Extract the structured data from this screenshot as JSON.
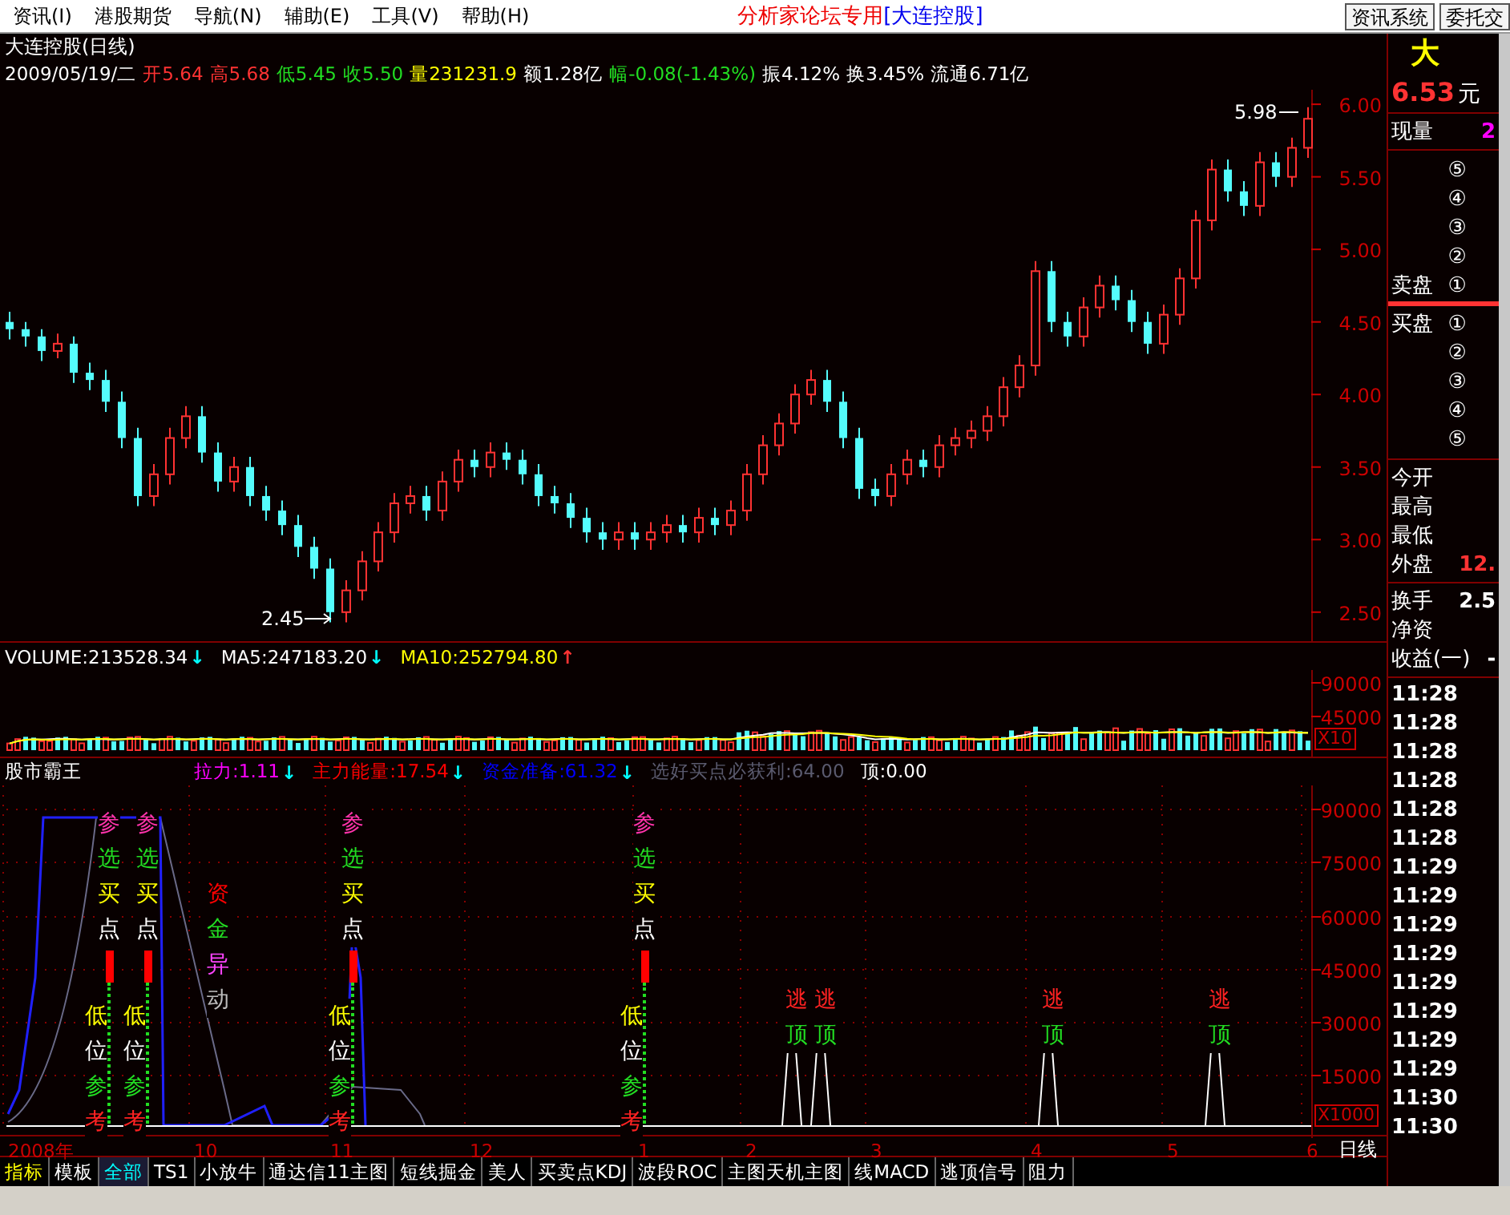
{
  "menu": [
    "资讯(I)",
    "港股期货",
    "导航(N)",
    "辅助(E)",
    "工具(V)",
    "帮助(H)"
  ],
  "banner": {
    "forum": "分析家论坛专用",
    "stock": "[大连控股]"
  },
  "top_buttons": [
    "资讯系统",
    "委托交"
  ],
  "chart": {
    "title": "大连控股(日线)",
    "quote": [
      {
        "kind": "plain",
        "text": "2009/05/19/二"
      },
      {
        "kind": "up",
        "text": "开5.64"
      },
      {
        "kind": "up",
        "text": "高5.68"
      },
      {
        "kind": "down",
        "text": "低5.45"
      },
      {
        "kind": "down",
        "text": "收5.50"
      },
      {
        "kind": "volume",
        "text": "量231231.9"
      },
      {
        "kind": "plain",
        "text": "额1.28亿"
      },
      {
        "kind": "down",
        "text": "幅-0.08(-1.43%)"
      },
      {
        "kind": "plain",
        "text": "振4.12%"
      },
      {
        "kind": "plain",
        "text": "换3.45%"
      },
      {
        "kind": "plain",
        "text": "流通6.71亿"
      }
    ],
    "high_mark": "5.98",
    "low_mark": "2.45",
    "chart_data": {
      "type": "candlestick",
      "ylim": [
        2.3,
        6.1
      ],
      "yticks": [
        {
          "value": 6,
          "label": "6.00"
        },
        {
          "value": 5.5,
          "label": "5.50"
        },
        {
          "value": 5,
          "label": "5.00"
        },
        {
          "value": 4.5,
          "label": "4.50"
        },
        {
          "value": 4,
          "label": "4.00"
        },
        {
          "value": 3.5,
          "label": "3.50"
        },
        {
          "value": 3,
          "label": "3.00"
        },
        {
          "value": 2.5,
          "label": "2.50"
        }
      ],
      "ohlc": [
        [
          4.5,
          4.57,
          4.38,
          4.45
        ],
        [
          4.45,
          4.5,
          4.33,
          4.4
        ],
        [
          4.4,
          4.45,
          4.23,
          4.3
        ],
        [
          4.3,
          4.42,
          4.25,
          4.35
        ],
        [
          4.35,
          4.4,
          4.08,
          4.15
        ],
        [
          4.15,
          4.22,
          4.03,
          4.1
        ],
        [
          4.1,
          4.17,
          3.88,
          3.95
        ],
        [
          3.95,
          4.02,
          3.63,
          3.7
        ],
        [
          3.7,
          3.77,
          3.23,
          3.3
        ],
        [
          3.3,
          3.52,
          3.23,
          3.45
        ],
        [
          3.45,
          3.77,
          3.38,
          3.7
        ],
        [
          3.7,
          3.92,
          3.63,
          3.85
        ],
        [
          3.85,
          3.92,
          3.53,
          3.6
        ],
        [
          3.6,
          3.67,
          3.33,
          3.4
        ],
        [
          3.4,
          3.57,
          3.33,
          3.5
        ],
        [
          3.5,
          3.57,
          3.23,
          3.3
        ],
        [
          3.3,
          3.37,
          3.13,
          3.2
        ],
        [
          3.2,
          3.27,
          3.03,
          3.1
        ],
        [
          3.1,
          3.17,
          2.88,
          2.95
        ],
        [
          2.95,
          3.02,
          2.73,
          2.8
        ],
        [
          2.8,
          2.87,
          2.43,
          2.5
        ],
        [
          2.5,
          2.72,
          2.43,
          2.65
        ],
        [
          2.65,
          2.92,
          2.58,
          2.85
        ],
        [
          2.85,
          3.12,
          2.78,
          3.05
        ],
        [
          3.05,
          3.32,
          2.98,
          3.25
        ],
        [
          3.25,
          3.37,
          3.18,
          3.3
        ],
        [
          3.3,
          3.37,
          3.13,
          3.2
        ],
        [
          3.2,
          3.47,
          3.13,
          3.4
        ],
        [
          3.4,
          3.62,
          3.33,
          3.55
        ],
        [
          3.55,
          3.62,
          3.43,
          3.5
        ],
        [
          3.5,
          3.67,
          3.43,
          3.6
        ],
        [
          3.6,
          3.67,
          3.48,
          3.55
        ],
        [
          3.55,
          3.62,
          3.38,
          3.45
        ],
        [
          3.45,
          3.52,
          3.23,
          3.3
        ],
        [
          3.3,
          3.37,
          3.18,
          3.25
        ],
        [
          3.25,
          3.32,
          3.08,
          3.15
        ],
        [
          3.15,
          3.22,
          2.98,
          3.05
        ],
        [
          3.05,
          3.12,
          2.93,
          3.0
        ],
        [
          3.0,
          3.12,
          2.93,
          3.05
        ],
        [
          3.05,
          3.12,
          2.93,
          3.0
        ],
        [
          3.0,
          3.12,
          2.93,
          3.05
        ],
        [
          3.05,
          3.17,
          2.98,
          3.1
        ],
        [
          3.1,
          3.17,
          2.98,
          3.05
        ],
        [
          3.05,
          3.22,
          2.98,
          3.15
        ],
        [
          3.15,
          3.22,
          3.03,
          3.1
        ],
        [
          3.1,
          3.27,
          3.03,
          3.2
        ],
        [
          3.2,
          3.52,
          3.13,
          3.45
        ],
        [
          3.45,
          3.72,
          3.38,
          3.65
        ],
        [
          3.65,
          3.87,
          3.58,
          3.8
        ],
        [
          3.8,
          4.07,
          3.73,
          4.0
        ],
        [
          4.0,
          4.17,
          3.93,
          4.1
        ],
        [
          4.1,
          4.17,
          3.88,
          3.95
        ],
        [
          3.95,
          4.02,
          3.63,
          3.7
        ],
        [
          3.7,
          3.77,
          3.28,
          3.35
        ],
        [
          3.35,
          3.42,
          3.23,
          3.3
        ],
        [
          3.3,
          3.52,
          3.23,
          3.45
        ],
        [
          3.45,
          3.62,
          3.38,
          3.55
        ],
        [
          3.55,
          3.62,
          3.43,
          3.5
        ],
        [
          3.5,
          3.72,
          3.43,
          3.65
        ],
        [
          3.65,
          3.77,
          3.58,
          3.7
        ],
        [
          3.7,
          3.82,
          3.63,
          3.75
        ],
        [
          3.75,
          3.92,
          3.68,
          3.85
        ],
        [
          3.85,
          4.12,
          3.78,
          4.05
        ],
        [
          4.05,
          4.27,
          3.98,
          4.2
        ],
        [
          4.2,
          4.92,
          4.13,
          4.85
        ],
        [
          4.85,
          4.92,
          4.43,
          4.5
        ],
        [
          4.5,
          4.57,
          4.33,
          4.4
        ],
        [
          4.4,
          4.67,
          4.33,
          4.6
        ],
        [
          4.6,
          4.82,
          4.53,
          4.75
        ],
        [
          4.75,
          4.82,
          4.58,
          4.65
        ],
        [
          4.65,
          4.72,
          4.43,
          4.5
        ],
        [
          4.5,
          4.57,
          4.28,
          4.35
        ],
        [
          4.35,
          4.62,
          4.28,
          4.55
        ],
        [
          4.55,
          4.87,
          4.48,
          4.8
        ],
        [
          4.8,
          5.27,
          4.73,
          5.2
        ],
        [
          5.2,
          5.62,
          5.13,
          5.55
        ],
        [
          5.55,
          5.62,
          5.33,
          5.4
        ],
        [
          5.4,
          5.47,
          5.23,
          5.3
        ],
        [
          5.3,
          5.67,
          5.23,
          5.6
        ],
        [
          5.6,
          5.67,
          5.43,
          5.5
        ],
        [
          5.5,
          5.77,
          5.43,
          5.7
        ],
        [
          5.7,
          5.98,
          5.63,
          5.9
        ]
      ]
    }
  },
  "volume": {
    "legend": [
      {
        "text": "VOLUME:213528.34",
        "color": "#ffffff",
        "arrow": {
          "text": "↓",
          "color": "#00ffff"
        }
      },
      {
        "text": "MA5:247183.20",
        "color": "#ffffff",
        "arrow": {
          "text": "↓",
          "color": "#00ffff"
        }
      },
      {
        "text": "MA10:252794.80",
        "color": "#ffff00",
        "arrow": {
          "text": "↑",
          "color": "#ff3333"
        }
      }
    ],
    "axis": [
      "90000",
      "45000"
    ],
    "scale": "X10"
  },
  "indicator": {
    "name": "股市霸王",
    "legend": [
      {
        "text": "拉力:1.11",
        "color": "#ff00ff",
        "arrow": {
          "text": "↓",
          "color": "#00ffff"
        }
      },
      {
        "text": "主力能量:17.54",
        "color": "#ff0000",
        "arrow": {
          "text": "↓",
          "color": "#00ffff"
        }
      },
      {
        "text": "资金准备:61.32",
        "color": "#0000ff",
        "arrow": {
          "text": "↓",
          "color": "#00ffff"
        }
      },
      {
        "text": "选好买点必获利:64.00",
        "color": "#5a5a6e"
      },
      {
        "text": "顶:0.00",
        "color": "#ffffff"
      }
    ],
    "axis": [
      "90000",
      "75000",
      "60000",
      "45000",
      "30000",
      "15000"
    ],
    "scale": "X1000",
    "signals": [
      {
        "kind": "buy",
        "top": "参选买点",
        "bottom": "低位参考"
      },
      {
        "kind": "buy",
        "top": "参选买点",
        "bottom": "低位参考"
      },
      {
        "kind": "fund",
        "top": "资金异动"
      },
      {
        "kind": "buy",
        "top": "参选买点",
        "bottom": "低位参考"
      },
      {
        "kind": "buy",
        "top": "参选买点",
        "bottom": "低位参考"
      },
      {
        "kind": "escape",
        "top": "逃顶"
      },
      {
        "kind": "escape",
        "top": "逃顶"
      },
      {
        "kind": "escape",
        "top": "逃顶"
      },
      {
        "kind": "escape",
        "top": "逃顶"
      }
    ]
  },
  "date_axis": [
    "2008年",
    "10",
    "11",
    "12",
    "1",
    "2",
    "3",
    "4",
    "5",
    "6"
  ],
  "period": "日线",
  "tabs": [
    {
      "label": "指标",
      "kind": "header",
      "selected": false
    },
    {
      "label": "模板",
      "kind": "tab",
      "selected": false
    },
    {
      "label": "全部",
      "kind": "tab",
      "selected": true
    },
    {
      "label": "TS1",
      "kind": "tab",
      "selected": false
    },
    {
      "label": "小放牛",
      "kind": "tab",
      "selected": false
    },
    {
      "label": "通达信11主图",
      "kind": "tab",
      "selected": false
    },
    {
      "label": "短线掘金",
      "kind": "tab",
      "selected": false
    },
    {
      "label": "美人",
      "kind": "tab",
      "selected": false
    },
    {
      "label": "买卖点KDJ",
      "kind": "tab",
      "selected": false
    },
    {
      "label": "波段ROC",
      "kind": "tab",
      "selected": false
    },
    {
      "label": "主图天机主图",
      "kind": "tab",
      "selected": false
    },
    {
      "label": "线MACD",
      "kind": "tab",
      "selected": false
    },
    {
      "label": "逃顶信号",
      "kind": "tab",
      "selected": false
    },
    {
      "label": "阻力",
      "kind": "tab",
      "selected": false
    }
  ],
  "quote_panel": {
    "name": "大",
    "price": "6.53",
    "unit": "元",
    "current_volume": {
      "label": "现量",
      "value": "2"
    },
    "asks": [
      "⑤",
      "④",
      "③",
      "②",
      "①"
    ],
    "ask_label": "卖盘",
    "bid_label": "买盘",
    "bids": [
      "①",
      "②",
      "③",
      "④",
      "⑤"
    ],
    "stats": [
      {
        "label": "今开"
      },
      {
        "label": "最高"
      },
      {
        "label": "最低"
      },
      {
        "label": "外盘",
        "value": "12."
      }
    ],
    "stats2": [
      {
        "label": "换手",
        "value": "2.5"
      },
      {
        "label": "净资"
      },
      {
        "label": "收益(一)",
        "value": "-"
      }
    ],
    "times": [
      "11:28",
      "11:28",
      "11:28",
      "11:28",
      "11:28",
      "11:28",
      "11:29",
      "11:29",
      "11:29",
      "11:29",
      "11:29",
      "11:29",
      "11:29",
      "11:29",
      "11:30",
      "11:30"
    ]
  }
}
